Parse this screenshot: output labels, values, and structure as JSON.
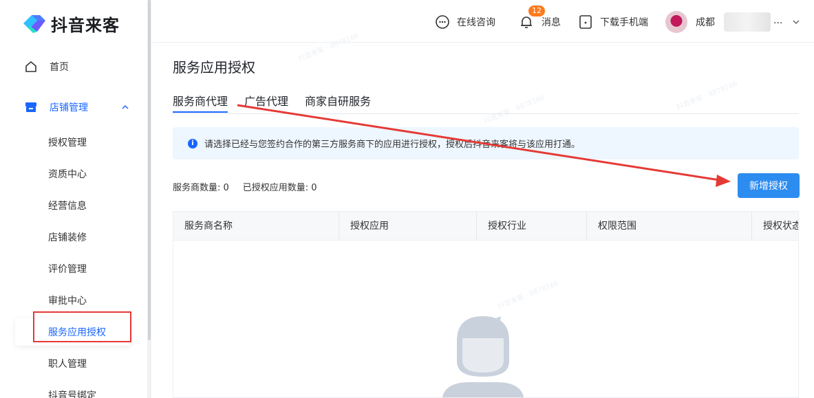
{
  "app": {
    "logo_text": "抖音来客"
  },
  "sidebar": {
    "home": "首页",
    "store_group": "店铺管理",
    "sub_items": [
      "授权管理",
      "资质中心",
      "经营信息",
      "店铺装修",
      "评价管理",
      "审批中心",
      "服务应用授权",
      "职人管理",
      "抖音号绑定"
    ],
    "active_item": "服务应用授权"
  },
  "topbar": {
    "consult": "在线咨询",
    "messages": "消息",
    "message_count": "12",
    "download": "下载手机端",
    "user_name_prefix": "成都",
    "user_ellipsis": "..."
  },
  "page": {
    "title": "服务应用授权",
    "tabs": [
      "服务商代理",
      "广告代理",
      "商家自研服务"
    ],
    "active_tab": "服务商代理",
    "notice": "请选择已经与您签约合作的第三方服务商下的应用进行授权，授权后抖音来客将与该应用打通。",
    "stats": {
      "provider_count": "服务商数量: 0",
      "authorized_count": "已授权应用数量: 0"
    },
    "add_button": "新增授权",
    "table_headers": [
      "服务商名称",
      "授权应用",
      "授权行业",
      "权限范围",
      "授权状态"
    ]
  },
  "colors": {
    "accent": "#1966ff",
    "button": "#2d8cf0",
    "annotation": "#e53935",
    "badge": "#ff7a1a"
  }
}
